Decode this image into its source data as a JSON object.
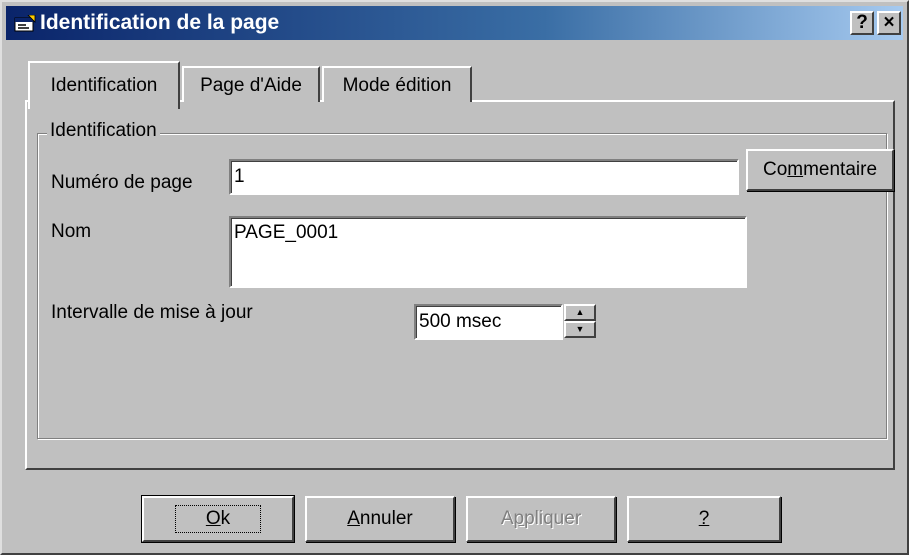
{
  "window": {
    "title": "Identification de la page",
    "help_button": "?",
    "close_button": "×"
  },
  "tabs": [
    {
      "label": "Identification",
      "active": true
    },
    {
      "label": "Page d'Aide",
      "active": false
    },
    {
      "label": "Mode édition",
      "active": false
    }
  ],
  "group": {
    "title": "Identification"
  },
  "fields": {
    "page_number_label": "Numéro de page",
    "page_number_value": "1",
    "comment_button": {
      "before": "Co",
      "mnemonic": "m",
      "after": "mentaire"
    },
    "name_label": "Nom",
    "name_value": "PAGE_0001",
    "interval_label": "Intervalle de mise à jour",
    "interval_value": "500 msec",
    "spin_up": "▲",
    "spin_down": "▼"
  },
  "buttons": {
    "ok": {
      "mnemonic": "O",
      "rest": "k"
    },
    "cancel": {
      "mnemonic": "A",
      "rest": "nnuler"
    },
    "apply": {
      "before": "A",
      "mnemonic": "p",
      "rest": "pliquer",
      "disabled": true
    },
    "help": {
      "mnemonic": "?",
      "rest": ""
    }
  },
  "colors": {
    "title_gradient_start": "#0a246a",
    "title_gradient_end": "#a6caf0",
    "face": "#c0c0c0",
    "disabled_text": "#808080"
  },
  "icons": {
    "app": "window-app-icon",
    "help": "help-icon",
    "close": "close-icon"
  }
}
